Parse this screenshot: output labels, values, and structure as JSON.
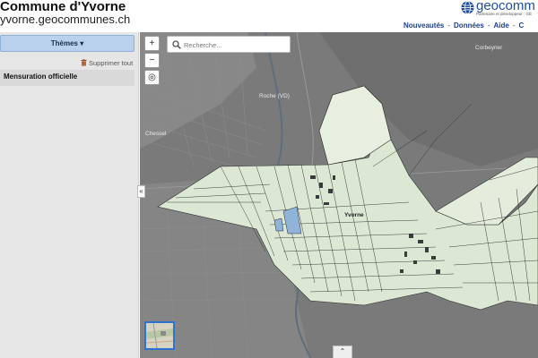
{
  "header": {
    "title": "Commune d'Yvorne",
    "url": "yvorne.geocommunes.ch",
    "logo_text": "geocomm",
    "logo_tagline": "Partenaire et développeur : GÉ",
    "nav": [
      "Nouveautés",
      "Données",
      "Aide",
      "C"
    ]
  },
  "sidebar": {
    "themes_label": "Thèmes ▾",
    "delete_all_label": "Supprimer tout",
    "layers": [
      "Mensuration officielle"
    ],
    "collapse_glyph": "«"
  },
  "map": {
    "search_placeholder": "Recherche...",
    "zoom_in": "+",
    "zoom_out": "−",
    "locate_glyph": "◎",
    "expand_glyph": "⌃",
    "place_labels": {
      "corbeyrier": "Corbeyrier",
      "roche": "Roche (VD)",
      "chessel": "Chessel",
      "yvorne": "Yvorne"
    }
  },
  "colors": {
    "brand_blue": "#1d3f94",
    "themes_button": "#b9d1ec",
    "parcel_fill": "#dfe9d6",
    "map_bg": "#7b7b7b"
  }
}
